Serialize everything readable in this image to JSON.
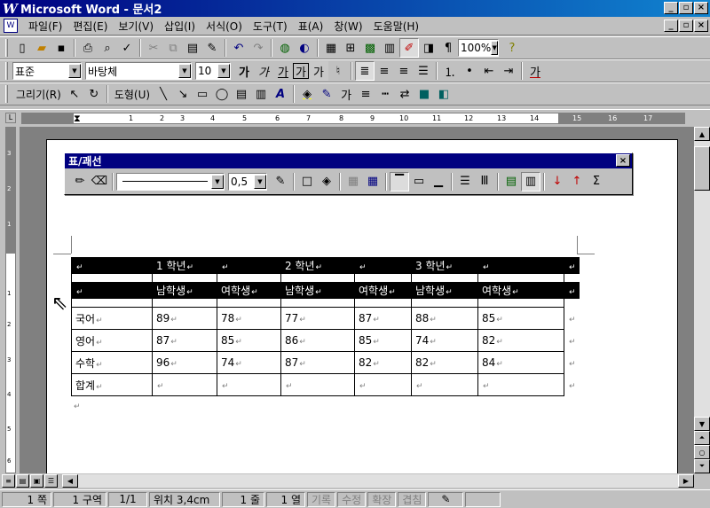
{
  "window": {
    "title": "Microsoft Word - 문서2",
    "min": "_",
    "restore": "▫",
    "close": "×"
  },
  "menu": [
    "파일(F)",
    "편집(E)",
    "보기(V)",
    "삽입(I)",
    "서식(O)",
    "도구(T)",
    "표(A)",
    "창(W)",
    "도움말(H)"
  ],
  "toolbar_standard": {
    "zoom": "100%"
  },
  "toolbar_format": {
    "style": "표준",
    "font": "바탕체",
    "size": "10"
  },
  "toolbar_drawing": {
    "draw": "그리기(R)",
    "autoshapes": "도형(U)"
  },
  "ruler": {
    "h_numbers": [
      "1",
      "2",
      "3",
      "4",
      "5",
      "6",
      "7",
      "8",
      "9",
      "10",
      "11",
      "12",
      "13",
      "14",
      "15",
      "16",
      "17"
    ],
    "v_numbers": [
      "3",
      "2",
      "1",
      "1",
      "2",
      "3",
      "4",
      "5",
      "6"
    ]
  },
  "tables_borders": {
    "title": "표/괘선",
    "line_weight": "0,5",
    "sigma": "Σ"
  },
  "table": {
    "header1": [
      "",
      "1 학년",
      "",
      "2 학년",
      "",
      "3 학년",
      "",
      ""
    ],
    "header2": [
      "",
      "남학생",
      "여학생",
      "남학생",
      "여학생",
      "남학생",
      "여학생",
      ""
    ],
    "rows": [
      [
        "국어",
        "89",
        "78",
        "77",
        "87",
        "88",
        "85"
      ],
      [
        "영어",
        "87",
        "85",
        "86",
        "85",
        "74",
        "82"
      ],
      [
        "수학",
        "96",
        "74",
        "87",
        "82",
        "82",
        "84"
      ],
      [
        "합계",
        "",
        "",
        "",
        "",
        "",
        ""
      ]
    ]
  },
  "paragraph_mark": "↵",
  "status": {
    "page": "1 쪽",
    "section": "1 구역",
    "pages": "1/1",
    "pos": "위치 3,4cm",
    "line": "1 줄",
    "col": "1 열",
    "rec": "기록",
    "trk": "수정",
    "ext": "확장",
    "ovr": "겹침"
  }
}
